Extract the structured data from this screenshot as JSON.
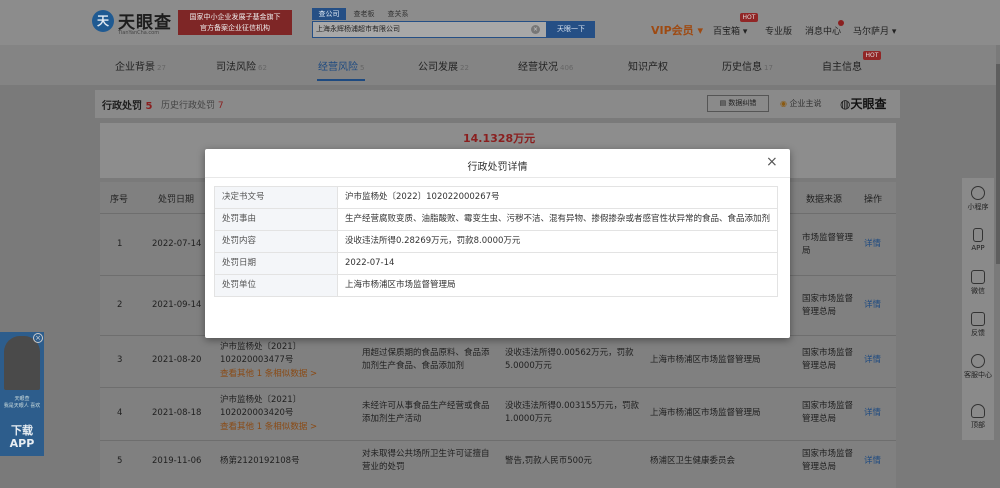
{
  "header": {
    "logo_mark": "天",
    "logo_name": "天眼查",
    "logo_domain": "TianYanCha.com",
    "banner_line1": "国家中小企业发展子基金旗下",
    "banner_line2": "官方备案企业征信机构",
    "search_tabs": [
      "查公司",
      "查老板",
      "查关系"
    ],
    "search_value": "上海永辉杨浦超市有限公司",
    "search_button": "天眼一下",
    "vip": "VIP会员",
    "links": [
      "百宝箱",
      "专业版",
      "消息中心",
      "马尔萨月"
    ],
    "hot": "HOT"
  },
  "nav": {
    "items": [
      {
        "label": "企业背景",
        "count": "27"
      },
      {
        "label": "司法风险",
        "count": "62"
      },
      {
        "label": "经营风险",
        "count": "5"
      },
      {
        "label": "公司发展",
        "count": "22"
      },
      {
        "label": "经营状况",
        "count": "406"
      },
      {
        "label": "知识产权",
        "count": ""
      },
      {
        "label": "历史信息",
        "count": "17"
      },
      {
        "label": "自主信息",
        "count": ""
      }
    ],
    "hot": "HOT"
  },
  "section": {
    "title": "行政处罚",
    "count": "5",
    "history": "历史行政处罚",
    "history_count": "7",
    "export": "数据纠错",
    "follow": "企业主说",
    "watermark": "天眼查"
  },
  "summary": {
    "amount": "14.1328万元"
  },
  "table": {
    "headers": [
      "序号",
      "处罚日期",
      "数据来源",
      "操作"
    ],
    "detail": "详情",
    "rows": [
      {
        "no": "1",
        "date": "2022-07-14",
        "source": "市场监督管理局"
      },
      {
        "no": "2",
        "date": "2021-09-14",
        "source": "国家市场监督管理总局"
      },
      {
        "no": "3",
        "date": "2021-08-20",
        "doc1": "沪市监杨处〔2021〕",
        "doc2": "102020003477号",
        "more": "查看其他 1 条相似数据 >",
        "reason": "用超过保质期的食品原料、食品添加剂生产食品、食品添加剂",
        "content": "没收违法所得0.00562万元，罚款5.0000万元",
        "org": "上海市杨浦区市场监督管理局",
        "source": "国家市场监督管理总局"
      },
      {
        "no": "4",
        "date": "2021-08-18",
        "doc1": "沪市监杨处〔2021〕",
        "doc2": "102020003420号",
        "more": "查看其他 1 条相似数据 >",
        "reason": "未经许可从事食品生产经营或食品添加剂生产活动",
        "content": "没收违法所得0.003155万元，罚款1.0000万元",
        "org": "上海市杨浦区市场监督管理局",
        "source": "国家市场监督管理总局"
      },
      {
        "no": "5",
        "date": "2019-11-06",
        "doc1": "杨第2120192108号",
        "reason": "对未取得公共场所卫生许可证擅自营业的处罚",
        "content": "警告,罚款人民币500元",
        "org": "杨浦区卫生健康委员会",
        "source": "国家市场监督管理总局"
      }
    ]
  },
  "modal": {
    "title": "行政处罚详情",
    "close": "×",
    "rows": [
      {
        "k": "决定书文号",
        "v": "沪市监杨处〔2022〕102022000267号"
      },
      {
        "k": "处罚事由",
        "v": "生产经营腐败变质、油脂酸败、霉变生虫、污秽不洁、混有异物、掺假掺杂或者感官性状异常的食品、食品添加剂"
      },
      {
        "k": "处罚内容",
        "v": "没收违法所得0.28269万元，罚款8.0000万元"
      },
      {
        "k": "处罚日期",
        "v": "2022-07-14"
      },
      {
        "k": "处罚单位",
        "v": "上海市杨浦区市场监督管理局"
      }
    ]
  },
  "right_float": [
    "小程序",
    "APP",
    "微信",
    "反馈",
    "客服中心",
    "顶部"
  ],
  "promo": {
    "close": "×",
    "text1": "天眼查",
    "text2": "我是天眼人 喜欢",
    "download": "下载",
    "app": "APP"
  }
}
